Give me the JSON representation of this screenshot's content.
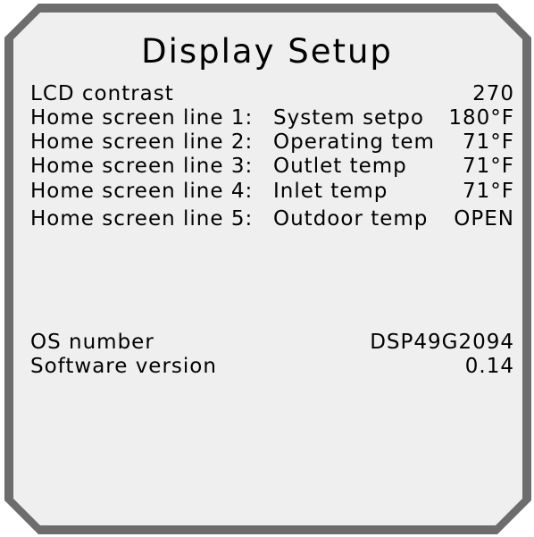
{
  "colors": {
    "bezel": "#6d6d6d",
    "screen": "#efefef",
    "text": "#000000"
  },
  "title": "Display Setup",
  "rows": [
    {
      "label": "LCD contrast",
      "desc": "",
      "value": "270"
    },
    {
      "label": "Home screen line 1:",
      "desc": "System setpo",
      "value": "180°F"
    },
    {
      "label": "Home screen line 2:",
      "desc": "Operating tem",
      "value": "71°F"
    },
    {
      "label": "Home screen line 3:",
      "desc": "Outlet temp",
      "value": "71°F"
    },
    {
      "label": "Home screen line 4:",
      "desc": "Inlet temp",
      "value": "71°F"
    },
    {
      "label": "Home screen line 5:",
      "desc": "Outdoor temp",
      "value": "OPEN"
    }
  ],
  "info": [
    {
      "label": "OS number",
      "value": "DSP49G2094"
    },
    {
      "label": "Software version",
      "value": "0.14"
    }
  ]
}
